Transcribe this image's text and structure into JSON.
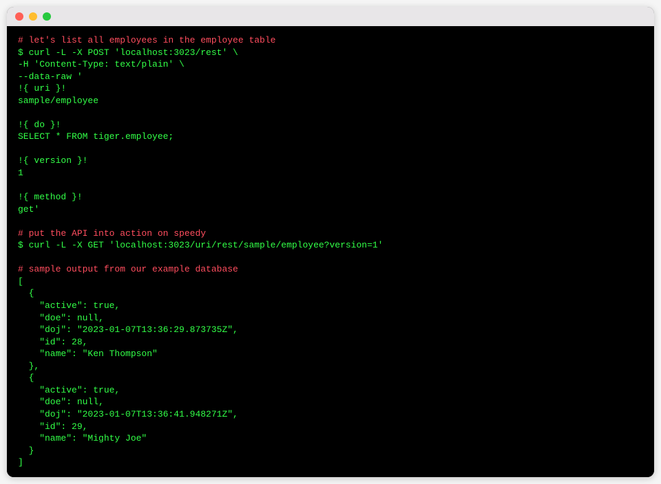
{
  "colors": {
    "comment": "#ff4d5e",
    "input": "#32ff47",
    "output": "#32ff47",
    "background": "#000000",
    "titlebar": "#e8e6e8"
  },
  "lines": [
    {
      "cls": "comment",
      "text": "# let's list all employees in the employee table"
    },
    {
      "cls": "cmd",
      "text": "$ curl -L -X POST 'localhost:3023/rest' \\"
    },
    {
      "cls": "cmd",
      "text": "-H 'Content-Type: text/plain' \\"
    },
    {
      "cls": "cmd",
      "text": "--data-raw '"
    },
    {
      "cls": "cmd",
      "text": "!{ uri }!"
    },
    {
      "cls": "cmd",
      "text": "sample/employee"
    },
    {
      "cls": "cmd",
      "text": ""
    },
    {
      "cls": "cmd",
      "text": "!{ do }!"
    },
    {
      "cls": "cmd",
      "text": "SELECT * FROM tiger.employee;"
    },
    {
      "cls": "cmd",
      "text": ""
    },
    {
      "cls": "cmd",
      "text": "!{ version }!"
    },
    {
      "cls": "cmd",
      "text": "1"
    },
    {
      "cls": "cmd",
      "text": ""
    },
    {
      "cls": "cmd",
      "text": "!{ method }!"
    },
    {
      "cls": "cmd",
      "text": "get'"
    },
    {
      "cls": "cmd",
      "text": ""
    },
    {
      "cls": "comment",
      "text": "# put the API into action on speedy"
    },
    {
      "cls": "cmd",
      "text": "$ curl -L -X GET 'localhost:3023/uri/rest/sample/employee?version=1'"
    },
    {
      "cls": "cmd",
      "text": ""
    },
    {
      "cls": "comment",
      "text": "# sample output from our example database"
    },
    {
      "cls": "output",
      "text": "["
    },
    {
      "cls": "output",
      "text": "  {"
    },
    {
      "cls": "output",
      "text": "    \"active\": true,"
    },
    {
      "cls": "output",
      "text": "    \"doe\": null,"
    },
    {
      "cls": "output",
      "text": "    \"doj\": \"2023-01-07T13:36:29.873735Z\","
    },
    {
      "cls": "output",
      "text": "    \"id\": 28,"
    },
    {
      "cls": "output",
      "text": "    \"name\": \"Ken Thompson\""
    },
    {
      "cls": "output",
      "text": "  },"
    },
    {
      "cls": "output",
      "text": "  {"
    },
    {
      "cls": "output",
      "text": "    \"active\": true,"
    },
    {
      "cls": "output",
      "text": "    \"doe\": null,"
    },
    {
      "cls": "output",
      "text": "    \"doj\": \"2023-01-07T13:36:41.948271Z\","
    },
    {
      "cls": "output",
      "text": "    \"id\": 29,"
    },
    {
      "cls": "output",
      "text": "    \"name\": \"Mighty Joe\""
    },
    {
      "cls": "output",
      "text": "  }"
    },
    {
      "cls": "output",
      "text": "]"
    }
  ]
}
